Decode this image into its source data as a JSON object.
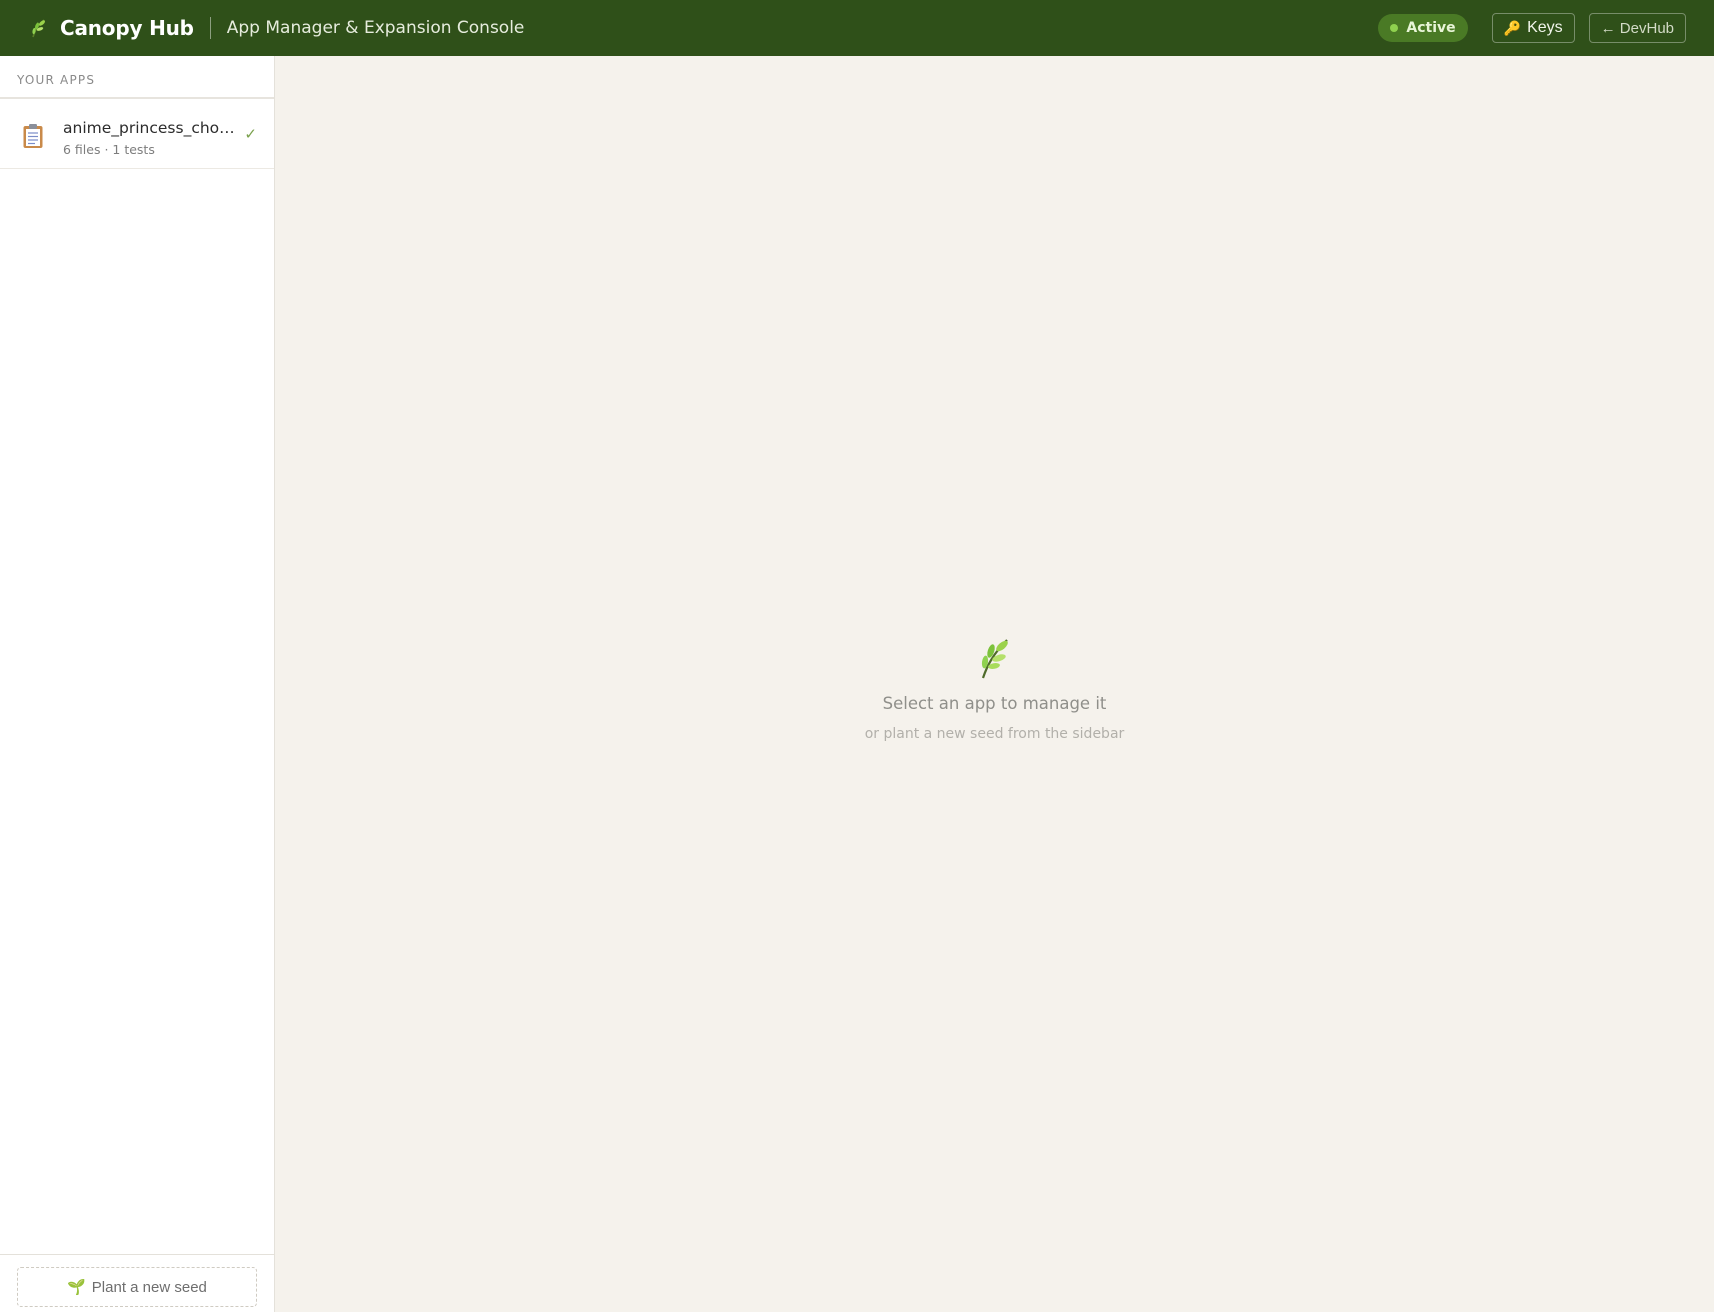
{
  "header": {
    "brand_icon": "leafy-branch-icon",
    "title": "Canopy Hub",
    "subtitle": "App Manager & Expansion Console",
    "status_label": "Active",
    "keys_label": "Keys",
    "keys_icon": "key-icon",
    "back_label": "← DevHub"
  },
  "sidebar": {
    "section_label": "YOUR APPS",
    "apps": [
      {
        "icon": "clipboard-icon",
        "name": "anime_princess_chor...",
        "meta": "6 files · 1 tests",
        "status_icon": "check-icon"
      }
    ],
    "new_button_label": "Plant a new seed",
    "new_button_icon": "seedling-icon"
  },
  "main": {
    "empty_icon": "leafy-branch-icon",
    "empty_title": "Select an app to manage it",
    "empty_subtitle": "or plant a new seed from the sidebar"
  },
  "colors": {
    "header_bg": "#2f5019",
    "status_pill_bg": "#4a7a25",
    "status_dot": "#8fd14f",
    "page_bg": "#f5f2ec",
    "sidebar_bg": "#ffffff",
    "check": "#7aa14c"
  }
}
